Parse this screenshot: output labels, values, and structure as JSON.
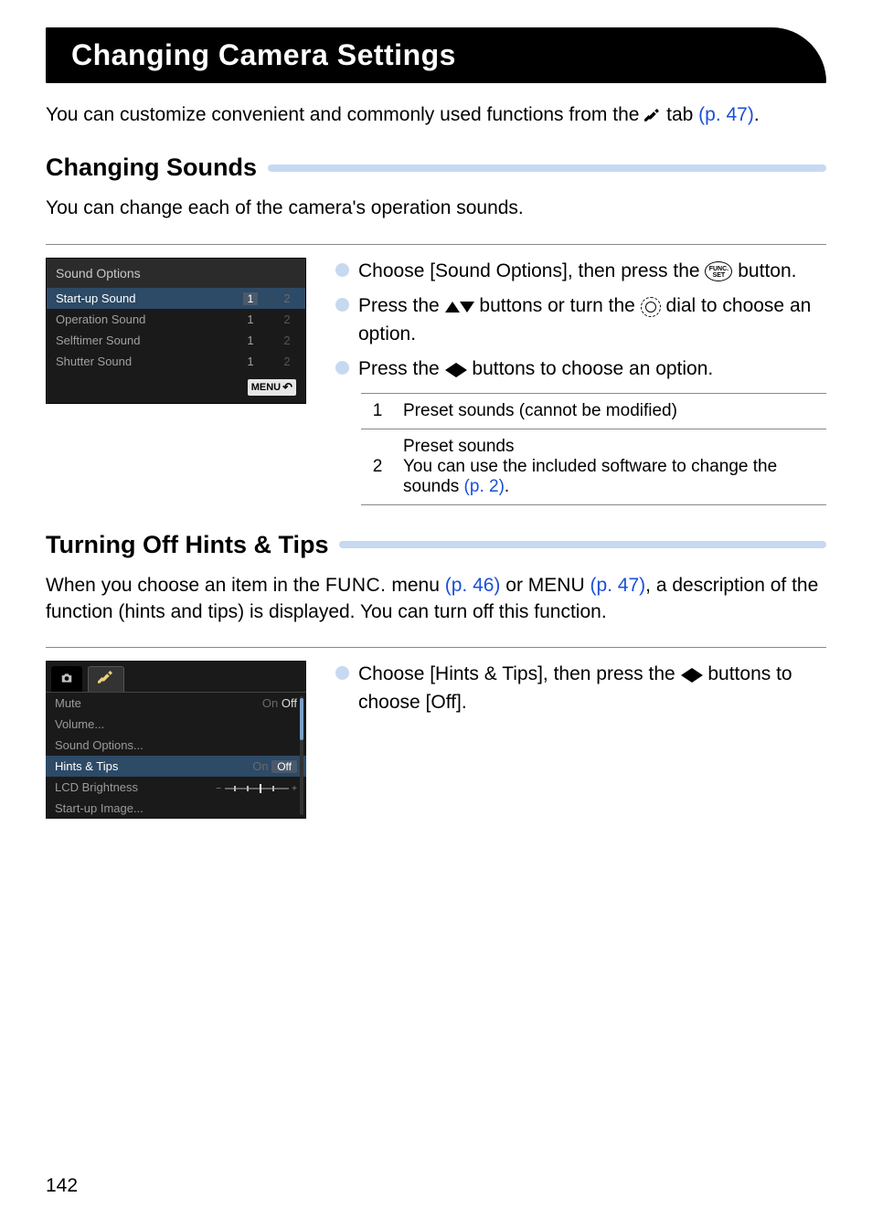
{
  "title": "Changing Camera Settings",
  "intro_prefix": "You can customize convenient and commonly used functions from the ",
  "intro_suffix": " tab ",
  "intro_link": "(p. 47)",
  "intro_period": ".",
  "section1": {
    "heading": "Changing Sounds",
    "desc": "You can change each of the camera's operation sounds.",
    "lcd": {
      "title": "Sound Options",
      "rows": [
        {
          "label": "Start-up Sound",
          "v1": "1",
          "v2": "2",
          "selected": true
        },
        {
          "label": "Operation Sound",
          "v1": "1",
          "v2": "2",
          "selected": false
        },
        {
          "label": "Selftimer Sound",
          "v1": "1",
          "v2": "2",
          "selected": false
        },
        {
          "label": "Shutter Sound",
          "v1": "1",
          "v2": "2",
          "selected": false
        }
      ],
      "menu": "MENU"
    },
    "bullets": {
      "b1_a": "Choose [Sound Options], then press the ",
      "b1_b": " button.",
      "b2_a": "Press the ",
      "b2_b": " buttons or turn the ",
      "b2_c": " dial to choose an option.",
      "b3_a": "Press the ",
      "b3_b": " buttons to choose an option."
    },
    "table": {
      "r1n": "1",
      "r1t": "Preset sounds (cannot be modified)",
      "r2n": "2",
      "r2t1": "Preset sounds",
      "r2t2_a": "You can use the included software to change the sounds ",
      "r2t2_link": "(p. 2)",
      "r2t2_b": "."
    }
  },
  "section2": {
    "heading": "Turning Off Hints & Tips",
    "desc_a": "When you choose an item in the ",
    "desc_func": "FUNC.",
    "desc_b": " menu ",
    "desc_link1": "(p. 46)",
    "desc_c": " or MENU ",
    "desc_link2": "(p. 47)",
    "desc_d": ", a description of the function (hints and tips) is displayed. You can turn off this function.",
    "lcd": {
      "rows": {
        "mute_label": "Mute",
        "mute_on": "On",
        "mute_off": "Off",
        "volume_label": "Volume...",
        "sound_label": "Sound Options...",
        "hints_label": "Hints & Tips",
        "hints_on": "On",
        "hints_off": "Off",
        "bright_label": "LCD Brightness",
        "startup_label": "Start-up Image..."
      }
    },
    "bullet_a": "Choose [Hints & Tips], then press the ",
    "bullet_b": " buttons to choose [Off]."
  },
  "page_number": "142"
}
